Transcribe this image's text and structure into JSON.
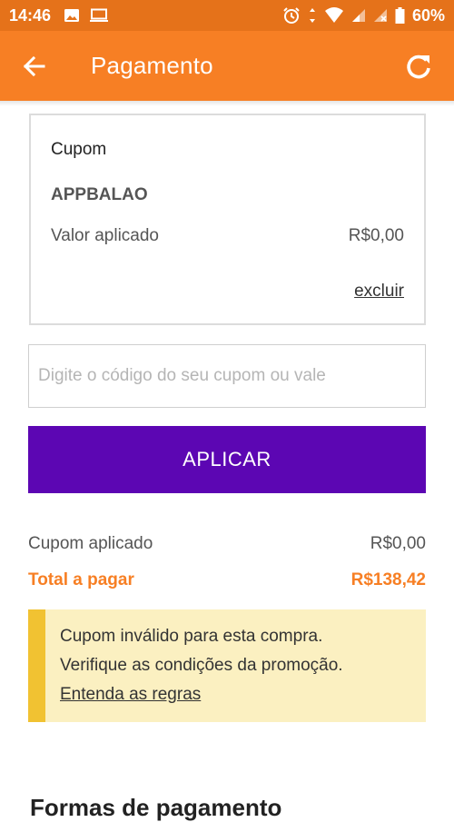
{
  "status_bar": {
    "time": "14:46",
    "battery": "60%",
    "icons_left": [
      "image-icon",
      "laptop-icon"
    ],
    "icons_right": [
      "alarm-icon",
      "data-arrows-icon",
      "wifi-icon",
      "signal-icon",
      "signal-icon",
      "battery-icon"
    ]
  },
  "app_bar": {
    "title": "Pagamento",
    "back_icon": "arrow-left-icon",
    "refresh_icon": "refresh-icon"
  },
  "coupon_card": {
    "heading": "Cupom",
    "code": "APPBALAO",
    "applied_label": "Valor aplicado",
    "applied_value": "R$0,00",
    "remove_label": "excluir"
  },
  "coupon_input": {
    "value": "",
    "placeholder": "Digite o código do seu cupom ou vale"
  },
  "apply_button": {
    "label": "APLICAR"
  },
  "summary": {
    "coupon_label": "Cupom aplicado",
    "coupon_value": "R$0,00",
    "total_label": "Total a pagar",
    "total_value": "R$138,42"
  },
  "warning": {
    "line1": "Cupom inválido para esta compra.",
    "line2": "Verifique as condições da promoção.",
    "link": "Entenda as regras"
  },
  "bottom": {
    "heading": "Formas de pagamento"
  },
  "colors": {
    "status_bar": "#e5721a",
    "app_bar": "#f77f24",
    "apply_button": "#5c06b3",
    "total_text": "#f77f24",
    "warning_bg": "#fbf0c1",
    "warning_accent": "#f1c232"
  }
}
